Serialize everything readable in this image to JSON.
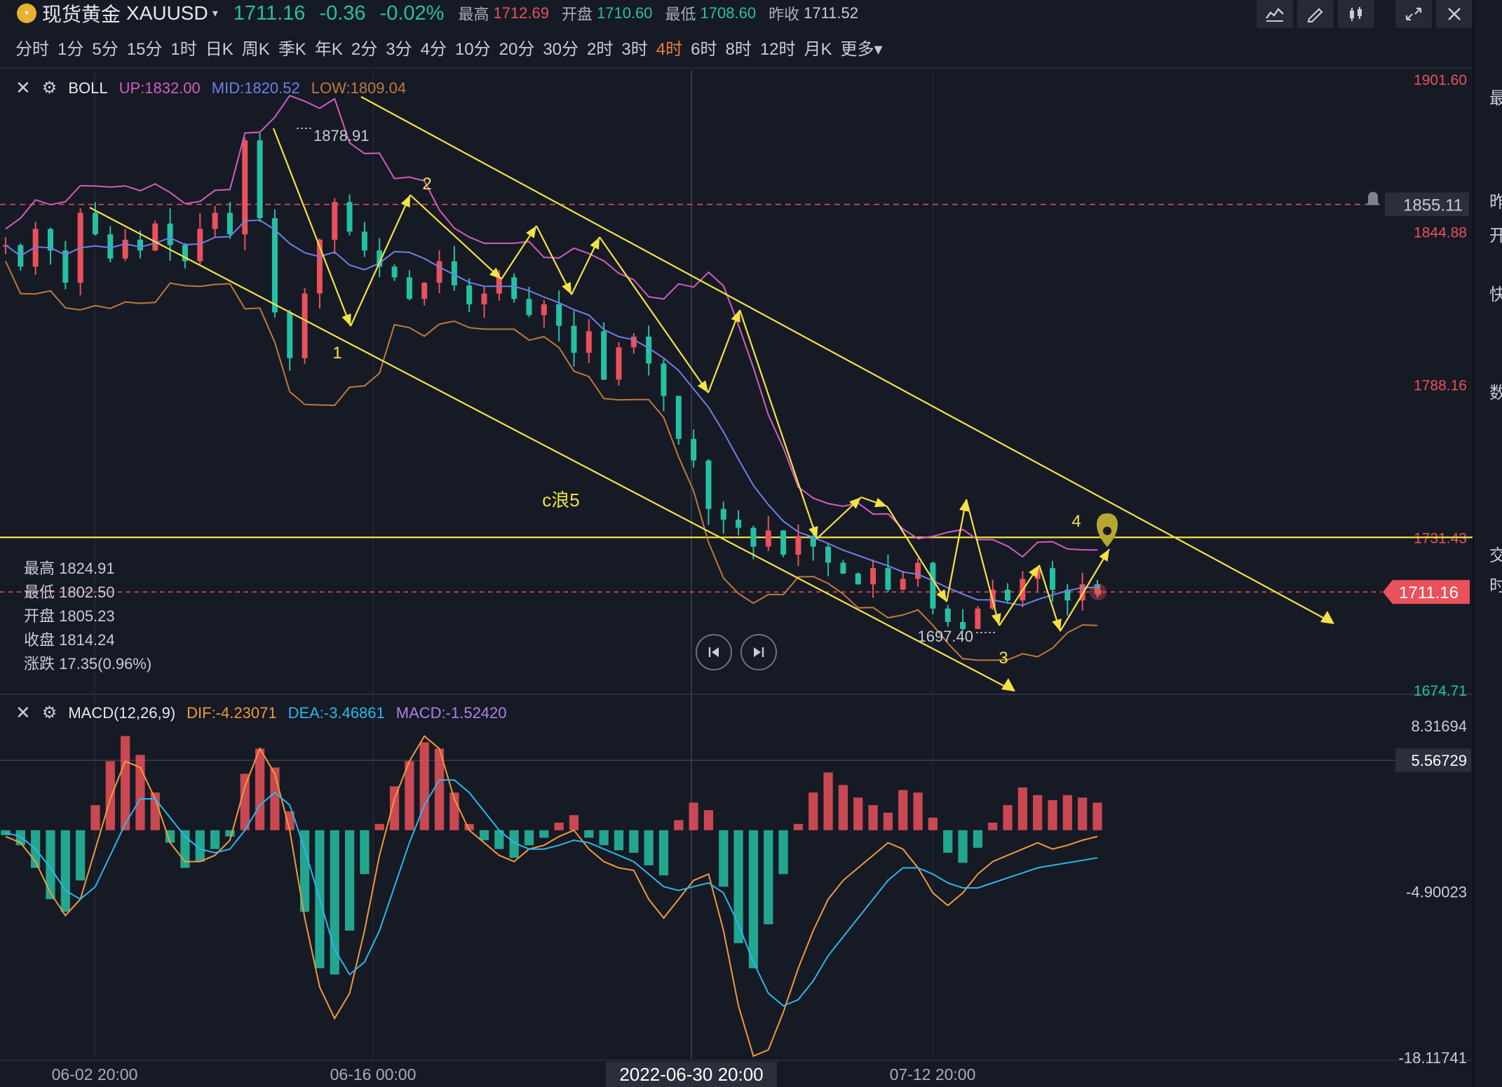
{
  "header": {
    "logo_glyph": "•",
    "name": "现货黄金",
    "symbol": "XAUUSD",
    "caret": "▾",
    "price": "1711.16",
    "change": "-0.36",
    "change_pct": "-0.02%",
    "high_label": "最高",
    "high": "1712.69",
    "open_label": "开盘",
    "open": "1710.60",
    "low_label": "最低",
    "low": "1708.60",
    "prev_label": "昨收",
    "prev": "1711.52",
    "tool_icons": [
      "indicator-icon",
      "draw-icon",
      "candle-type-icon",
      "fullscreen-icon",
      "close-icon"
    ]
  },
  "periods": [
    "分时",
    "1分",
    "5分",
    "15分",
    "1时",
    "日K",
    "周K",
    "季K",
    "年K",
    "2分",
    "3分",
    "4分",
    "10分",
    "20分",
    "30分",
    "2时",
    "3时",
    "4时",
    "6时",
    "8时",
    "12时",
    "月K",
    "更多▾"
  ],
  "active_period": "4时",
  "boll": {
    "label": "BOLL",
    "up": "UP:1832.00",
    "mid": "MID:1820.52",
    "low": "LOW:1809.04"
  },
  "macd": {
    "label": "MACD(12,26,9)",
    "dif": "DIF:-4.23071",
    "dea": "DEA:-3.46861",
    "macd": "MACD:-1.52420"
  },
  "info": {
    "high": "最高 1824.91",
    "low": "最低 1802.50",
    "open": "开盘 1805.23",
    "close": "收盘 1814.24",
    "change": "涨跌 17.35(0.96%)"
  },
  "price_axis": [
    "1901.60",
    "1844.88",
    "1788.16",
    "1731.43",
    "1674.71"
  ],
  "price_tags": {
    "alert": "1855.11",
    "current": "1711.16"
  },
  "macd_axis": [
    "8.31694",
    "5.56729",
    "-4.90023",
    "-18.11741"
  ],
  "time_axis": [
    "06-02 20:00",
    "06-16 00:00",
    "2022-06-30 20:00",
    "07-12 20:00"
  ],
  "annotations": {
    "peak": "1878.91",
    "trough": "1697.40",
    "wave_c": "c浪5",
    "w1": "1",
    "w2": "2",
    "w3": "3",
    "w4": "4"
  },
  "right_strip": [
    "最",
    "昨",
    "开",
    "快",
    "数",
    "交",
    "时"
  ],
  "chart_data": {
    "type": "candlestick",
    "instrument": "XAUUSD",
    "period": "4时",
    "price_range": [
      1674.71,
      1901.6
    ],
    "price_ticks": [
      1901.6,
      1844.88,
      1788.16,
      1731.43,
      1674.71
    ],
    "time_ticks": [
      "06-02 20:00",
      "06-16 00:00",
      "2022-06-30 20:00",
      "07-12 20:00"
    ],
    "horizontal_lines": [
      1855.11,
      1731.43,
      1711.16
    ],
    "price_path": [
      1840,
      1832,
      1846,
      1838,
      1826,
      1852,
      1844,
      1835,
      1842,
      1838,
      1848,
      1840,
      1834,
      1846,
      1852,
      1844,
      1878.91,
      1850,
      1815,
      1798,
      1822,
      1842,
      1856,
      1845,
      1838,
      1832,
      1828,
      1820,
      1826,
      1834,
      1825,
      1818,
      1822,
      1828,
      1820,
      1814,
      1818,
      1810,
      1800,
      1808,
      1790,
      1802,
      1806,
      1796,
      1784,
      1768,
      1760,
      1742,
      1738,
      1735,
      1728,
      1734,
      1725,
      1732,
      1728,
      1722,
      1718,
      1714,
      1720,
      1712,
      1716,
      1722,
      1705,
      1700,
      1697.4,
      1705,
      1712,
      1708,
      1716,
      1720,
      1712,
      1708,
      1714,
      1711.16
    ],
    "macd_range": [
      -18.11741,
      8.31694
    ],
    "macd_ticks": [
      8.31694,
      5.56729,
      -4.90023,
      -18.11741
    ],
    "macd_hist": [
      -0.4,
      -1.2,
      -3.0,
      -5.5,
      -6.5,
      -4.0,
      2.0,
      5.5,
      7.5,
      6.0,
      3.0,
      -1.0,
      -3.0,
      -2.5,
      -1.5,
      -0.5,
      4.5,
      6.5,
      5.0,
      1.5,
      -6.5,
      -11.0,
      -11.5,
      -8.0,
      -3.5,
      0.5,
      3.5,
      5.5,
      7.0,
      6.5,
      3.0,
      0.5,
      -0.8,
      -1.5,
      -2.2,
      -1.2,
      -0.6,
      0.6,
      1.2,
      -0.6,
      -1.2,
      -1.6,
      -1.8,
      -2.8,
      -3.6,
      0.8,
      2.2,
      1.6,
      -4.5,
      -9.0,
      -11.0,
      -7.5,
      -3.5,
      0.5,
      3.0,
      4.6,
      3.6,
      2.6,
      2.0,
      1.4,
      3.2,
      3.0,
      1.0,
      -1.8,
      -2.6,
      -1.4,
      0.6,
      2.0,
      3.4,
      2.8,
      2.4,
      2.8,
      2.6,
      2.2
    ],
    "dif": [
      -0.5,
      -1.0,
      -2.5,
      -5.0,
      -6.8,
      -5.5,
      -1.5,
      2.5,
      5.5,
      5.0,
      2.5,
      -1.0,
      -2.5,
      -2.5,
      -2.0,
      -0.8,
      3.5,
      6.5,
      4.5,
      0.0,
      -7.0,
      -12.5,
      -15.0,
      -13.0,
      -8.0,
      -2.0,
      2.5,
      5.5,
      7.5,
      6.5,
      2.5,
      0.0,
      -1.0,
      -2.0,
      -2.5,
      -1.5,
      -1.2,
      -0.5,
      0.0,
      -1.5,
      -2.5,
      -3.0,
      -3.2,
      -5.5,
      -7.0,
      -5.5,
      -4.0,
      -3.5,
      -8.0,
      -14.0,
      -18.0,
      -17.5,
      -14.5,
      -11.0,
      -8.0,
      -5.5,
      -4.0,
      -3.0,
      -2.0,
      -1.0,
      -1.5,
      -3.0,
      -5.0,
      -6.0,
      -5.0,
      -3.5,
      -2.5,
      -2.0,
      -1.5,
      -1.0,
      -1.5,
      -1.2,
      -0.8,
      -0.5
    ],
    "dea": [
      -0.2,
      -0.5,
      -1.5,
      -3.0,
      -4.8,
      -5.5,
      -4.5,
      -2.0,
      0.5,
      2.5,
      2.5,
      1.0,
      -0.5,
      -1.5,
      -1.8,
      -1.5,
      0.0,
      2.0,
      3.0,
      2.0,
      -1.5,
      -5.5,
      -9.5,
      -11.5,
      -10.5,
      -8.0,
      -4.5,
      -1.0,
      2.0,
      4.0,
      4.0,
      3.0,
      1.5,
      0.0,
      -1.0,
      -1.5,
      -1.5,
      -1.2,
      -0.8,
      -1.0,
      -1.5,
      -2.0,
      -2.5,
      -3.5,
      -4.5,
      -4.8,
      -4.5,
      -4.2,
      -5.0,
      -7.5,
      -10.5,
      -13.0,
      -14.0,
      -13.5,
      -12.0,
      -10.0,
      -8.5,
      -7.0,
      -5.5,
      -4.0,
      -3.0,
      -3.0,
      -3.5,
      -4.2,
      -4.6,
      -4.6,
      -4.2,
      -3.8,
      -3.4,
      -3.0,
      -2.8,
      -2.6,
      -2.4,
      -2.2
    ]
  }
}
